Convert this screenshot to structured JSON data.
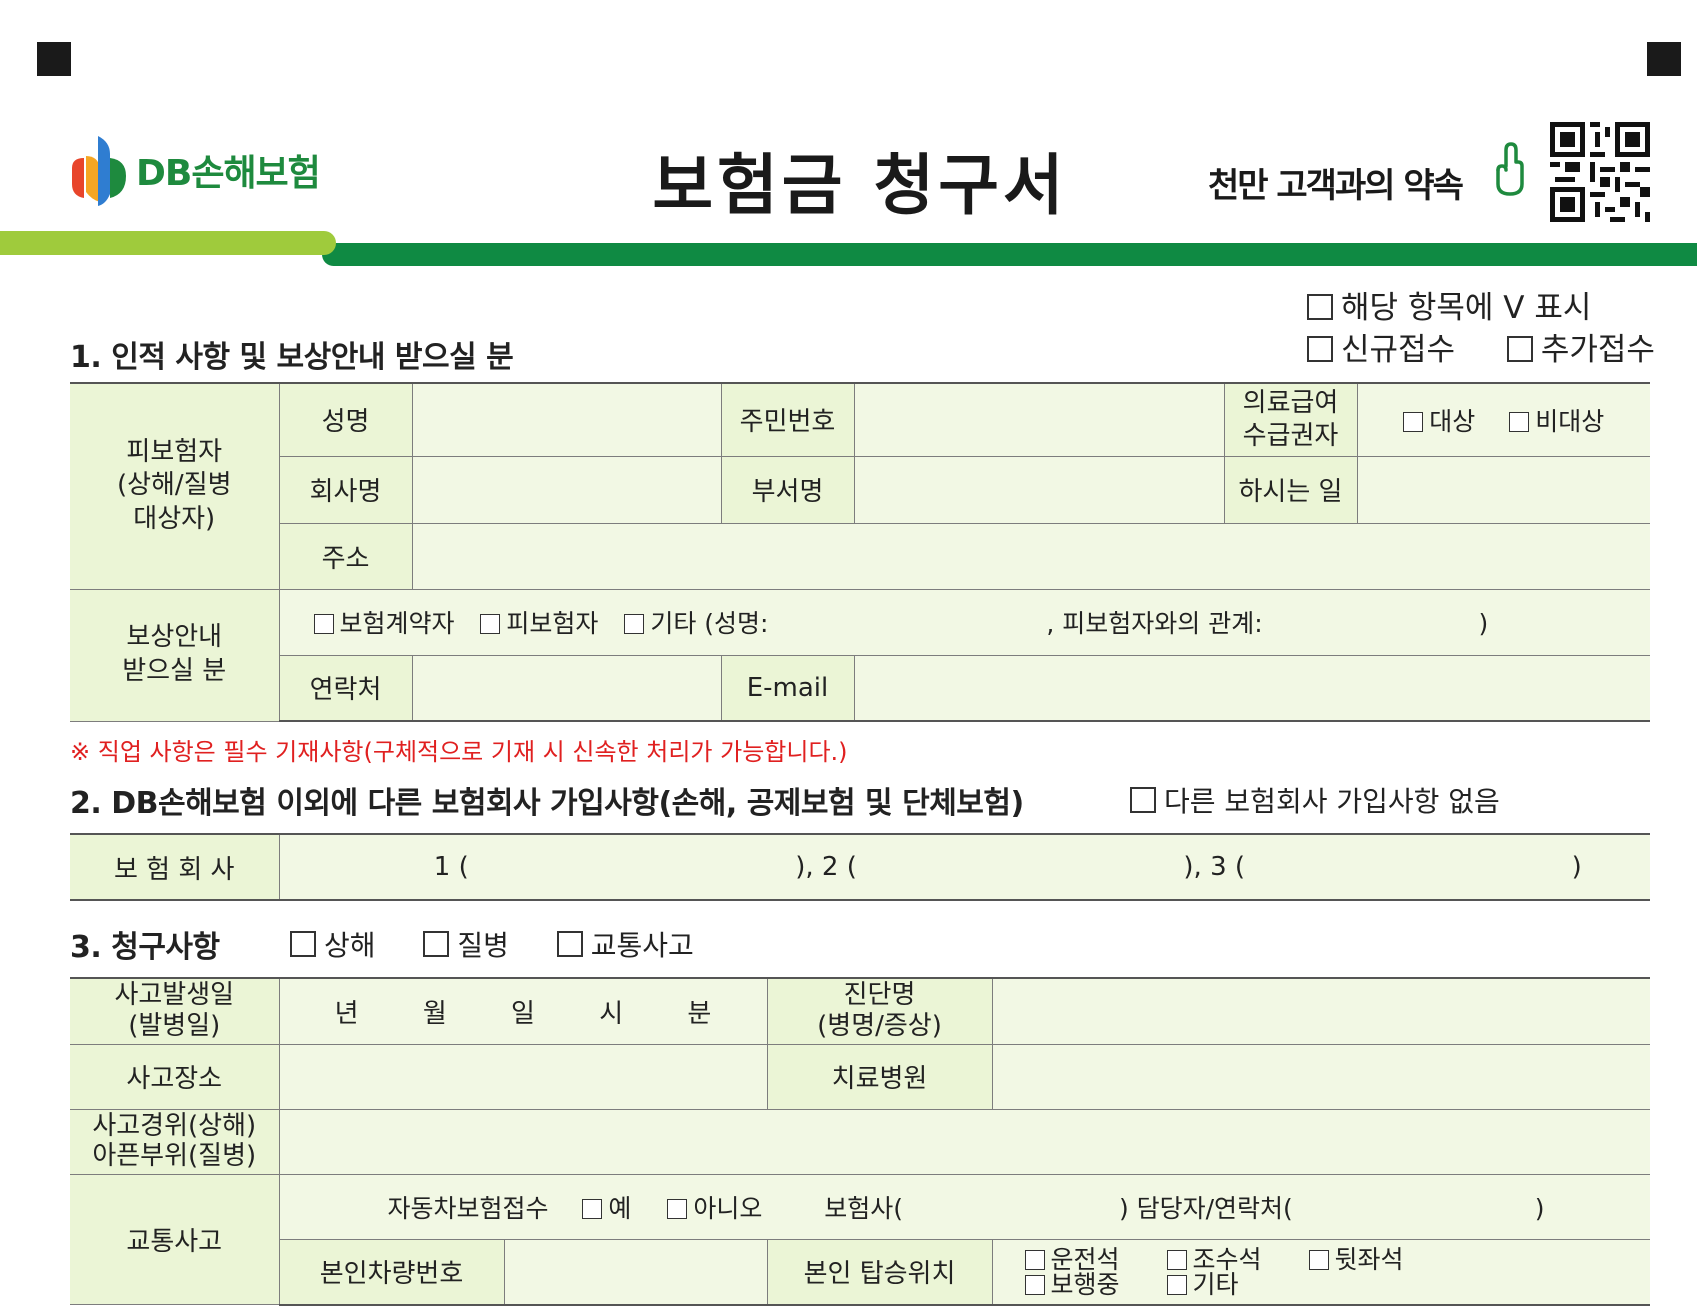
{
  "header": {
    "brand": "DB손해보험",
    "title": "보험금 청구서",
    "promise": "천만 고객과의 약속"
  },
  "top_options": {
    "mark_hint": "해당 항목에 V 표시",
    "new_claim": "신규접수",
    "additional_claim": "추가접수"
  },
  "section1": {
    "title": "1. 인적 사항 및 보상안내 받으실 분",
    "insured_label": "피보험자\n(상해/질병\n대상자)",
    "name_label": "성명",
    "rrn_label": "주민번호",
    "medical_aid_label": "의료급여\n수급권자",
    "target": "대상",
    "non_target": "비대상",
    "company_label": "회사명",
    "dept_label": "부서명",
    "job_label": "하시는 일",
    "address_label": "주소",
    "guide_label": "보상안내\n받으실 분",
    "policyholder": "보험계약자",
    "insured": "피보험자",
    "other": "기타 (성명:",
    "relation": ", 피보험자와의 관계:",
    "close_paren": ")",
    "contact_label": "연락처",
    "email_label": "E-mail"
  },
  "note": "※ 직업 사항은 필수 기재사항(구체적으로 기재 시 신속한 처리가 가능합니다.)",
  "section2": {
    "title": "2. DB손해보험 이외에 다른 보험회사 가입사항(손해, 공제보험 및 단체보험)",
    "none_option": "다른 보험회사 가입사항 없음",
    "insurer_label": "보 험 회 사",
    "slot1": "1 (",
    "slot2": "), 2 (",
    "slot3": "), 3 (",
    "slot_end": ")"
  },
  "section3": {
    "title": "3. 청구사항",
    "injury": "상해",
    "disease": "질병",
    "traffic": "교통사고",
    "accident_date_label": "사고발생일\n(발병일)",
    "year": "년",
    "month": "월",
    "day": "일",
    "hour": "시",
    "minute": "분",
    "diagnosis_label": "진단명\n(병명/증상)",
    "place_label": "사고장소",
    "hospital_label": "치료병원",
    "course_label": "사고경위(상해)\n아픈부위(질병)",
    "traffic_label": "교통사고",
    "car_ins_label": "자동차보험접수",
    "yes": "예",
    "no": "아니오",
    "insurer_open": "보험사(",
    "contact_open": ") 담당자/연락처(",
    "close": ")",
    "vehicle_no_label": "본인차량번호",
    "seat_label": "본인 탑승위치",
    "seat_driver": "운전석",
    "seat_passenger": "조수석",
    "seat_back": "뒷좌석",
    "seat_walking": "보행중",
    "seat_other": "기타"
  },
  "colors": {
    "brand_green": "#0f8a43",
    "light_green_bar": "#9fcb3c",
    "label_bg": "#ebf5d6",
    "note_red": "#e02020"
  }
}
